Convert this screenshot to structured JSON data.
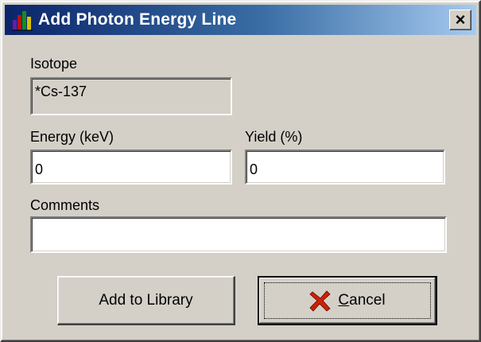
{
  "window": {
    "title": "Add Photon Energy Line",
    "close_glyph": "×"
  },
  "isotope": {
    "label": "Isotope",
    "value": "*Cs-137"
  },
  "energy": {
    "label": "Energy (keV)",
    "value": "0"
  },
  "yield": {
    "label": "Yield (%)",
    "value": "0"
  },
  "comments": {
    "label": "Comments",
    "value": ""
  },
  "buttons": {
    "add_label": "Add to Library",
    "cancel_mnemonic": "C",
    "cancel_rest": "ancel"
  },
  "icons": {
    "app": "bar-chart-icon",
    "cancel": "red-x-icon"
  },
  "colors": {
    "title_gradient_start": "#0a246a",
    "title_gradient_end": "#a6caf0",
    "cancel_x": "#cc2200"
  }
}
